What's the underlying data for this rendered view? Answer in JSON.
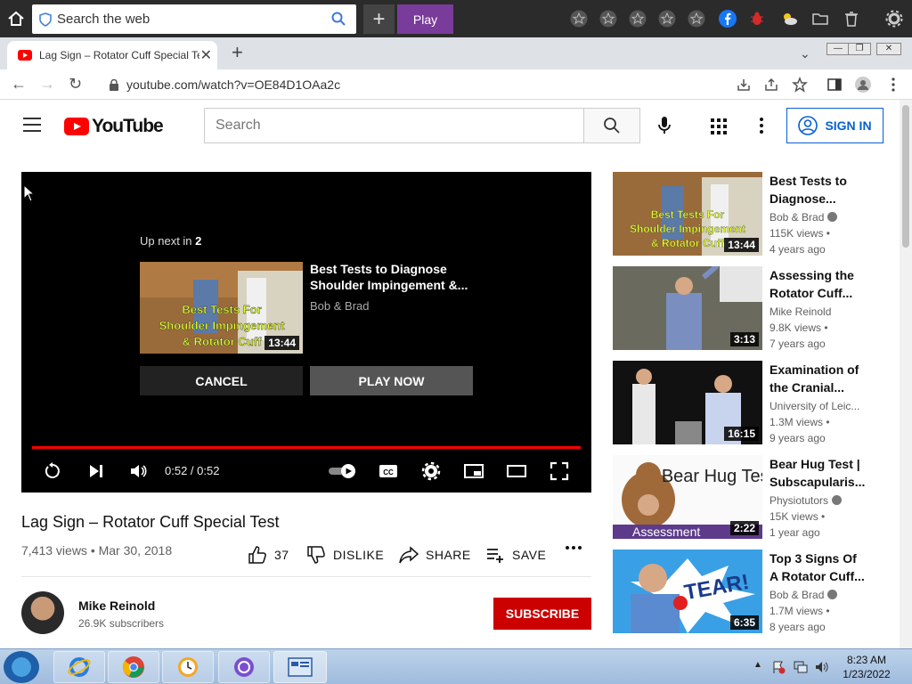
{
  "launcher": {
    "search_placeholder": "Search the web",
    "play_label": "Play",
    "plus_label": "+"
  },
  "tab": {
    "title": "Lag Sign – Rotator Cuff Special Te",
    "close": "✕",
    "new_tab": "+"
  },
  "address": {
    "url": "youtube.com/watch?v=OE84D1OAa2c"
  },
  "youtube": {
    "logo_text": "YouTube",
    "search_placeholder": "Search",
    "sign_in": "SIGN IN"
  },
  "player": {
    "up_next_prefix": "Up next in ",
    "up_next_count": "2",
    "next_title": "Best Tests to Diagnose Shoulder Impingement &...",
    "next_channel": "Bob & Brad",
    "next_duration": "13:44",
    "thumb_caption_1": "Best Tests For",
    "thumb_caption_2": "Shoulder Impingement",
    "thumb_caption_3": "& Rotator Cuff",
    "cancel": "CANCEL",
    "play_now": "PLAY NOW",
    "time": "0:52 / 0:52",
    "progress": 1.0
  },
  "video": {
    "title": "Lag Sign – Rotator Cuff Special Test",
    "meta": "7,413 views • Mar 30, 2018",
    "likes": "37",
    "dislike": "DISLIKE",
    "share": "SHARE",
    "save": "SAVE"
  },
  "channel": {
    "name": "Mike Reinold",
    "subscribers": "26.9K subscribers",
    "subscribe": "SUBSCRIBE"
  },
  "recommendations": [
    {
      "title": "Best Tests to\nDiagnose...",
      "channel": "Bob & Brad",
      "verified": true,
      "views": "115K views •",
      "age": "4 years ago",
      "duration": "13:44"
    },
    {
      "title": "Assessing the\nRotator Cuff...",
      "channel": "Mike Reinold",
      "verified": false,
      "views": "9.8K views •",
      "age": "7 years ago",
      "duration": "3:13"
    },
    {
      "title": "Examination of\nthe Cranial...",
      "channel": "University of Leic...",
      "verified": false,
      "views": "1.3M views •",
      "age": "9 years ago",
      "duration": "16:15"
    },
    {
      "title": "Bear Hug Test |\nSubscapularis...",
      "channel": "Physiotutors",
      "verified": true,
      "views": "15K views •",
      "age": "1 year ago",
      "duration": "2:22",
      "thumb_text": "Bear Hug Test",
      "thumb_banner": "Assessment"
    },
    {
      "title": "Top 3 Signs Of\nA Rotator Cuff...",
      "channel": "Bob & Brad",
      "verified": true,
      "views": "1.7M views •",
      "age": "8 years ago",
      "duration": "6:35",
      "thumb_text": "TEAR!"
    }
  ],
  "taskbar": {
    "time": "8:23 AM",
    "date": "1/23/2022"
  },
  "colors": {
    "youtube_red": "#ff0000",
    "subscribe_red": "#cc0000",
    "signin_blue": "#065fd4",
    "play_purple": "#7a3c9a"
  }
}
